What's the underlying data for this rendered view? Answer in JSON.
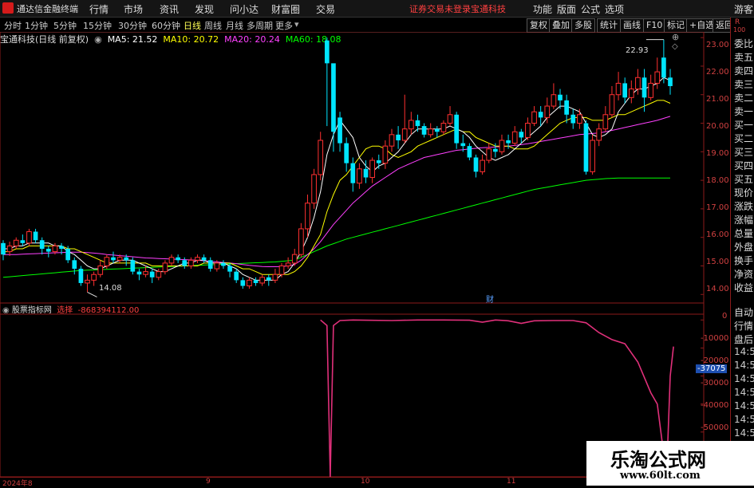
{
  "app": {
    "title": "通达信金融终端"
  },
  "menu": {
    "items": [
      "行情",
      "市场",
      "资讯",
      "发现",
      "问小达",
      "财富圈",
      "交易"
    ],
    "notice": "证券交易未登录",
    "stock_name": "宝通科技",
    "right_items": [
      "功能",
      "版面",
      "公式",
      "选项"
    ],
    "guest": "游客"
  },
  "periods": {
    "tabs": [
      "分时",
      "1分钟",
      "5分钟",
      "15分钟",
      "30分钟",
      "60分钟",
      "日线",
      "周线",
      "月线",
      "多周期",
      "更多"
    ],
    "active": "日线"
  },
  "toolbar_right": [
    "复权",
    "叠加",
    "多股",
    "统计",
    "画线",
    "F10",
    "标记",
    "+自选",
    "返回"
  ],
  "info": {
    "stock_label": "宝通科技(日线 前复权)",
    "ma5": "MA5: 21.52",
    "ma10": "MA10: 20.72",
    "ma20": "MA20: 20.24",
    "ma60": "MA60: 18.08",
    "colors": {
      "ma5": "#ffffff",
      "ma10": "#ffff00",
      "ma20": "#ff40ff",
      "ma60": "#00ff00"
    }
  },
  "main_chart": {
    "y_ticks": [
      "23.00",
      "22.00",
      "21.00",
      "20.00",
      "19.00",
      "18.00",
      "17.00",
      "16.00",
      "15.00",
      "14.00"
    ],
    "high_label": "22.93",
    "low_label": "14.08",
    "event_label": "财"
  },
  "indicator": {
    "title": "股票指标网",
    "mode": "选择",
    "value": "-868394112.00",
    "y_ticks": [
      "0",
      "-10000",
      "-20000",
      "-30000",
      "-40000",
      "-50000"
    ],
    "current_label": "-37075",
    "line_color": "#e0307a"
  },
  "xaxis": {
    "labels": [
      "2024年8",
      "9",
      "10",
      "11"
    ]
  },
  "right_panel": {
    "top_labels": [
      "R",
      "100"
    ],
    "items": [
      "委比",
      "卖五",
      "卖四",
      "卖三",
      "卖二",
      "卖一",
      "买一",
      "买二",
      "买三",
      "买四",
      "买五",
      "现价",
      "涨跌",
      "涨幅",
      "总量",
      "外盘",
      "换手",
      "净资",
      "收益"
    ],
    "lower_items": [
      "自动",
      "行情",
      "盘后",
      "14:5",
      "14:5",
      "14:5",
      "14:5",
      "14:5",
      "14:5",
      "14:5",
      "14:5",
      "14:5"
    ]
  },
  "watermark": {
    "line1": "乐淘公式网",
    "line2": "www.60lt.com"
  },
  "chart_data": {
    "type": "candlestick",
    "up_color": "#ff3030",
    "down_color": "#00e5ff",
    "ylim": [
      13.7,
      23.2
    ],
    "candles": [
      [
        15.8,
        15.4,
        15.9,
        15.2
      ],
      [
        15.5,
        15.7,
        15.85,
        15.35
      ],
      [
        15.7,
        15.9,
        16.0,
        15.6
      ],
      [
        15.9,
        15.8,
        16.1,
        15.7
      ],
      [
        15.8,
        16.2,
        16.3,
        15.7
      ],
      [
        16.2,
        15.9,
        16.3,
        15.8
      ],
      [
        15.9,
        15.6,
        16.0,
        15.4
      ],
      [
        15.6,
        15.5,
        15.7,
        15.3
      ],
      [
        15.5,
        15.7,
        15.8,
        15.4
      ],
      [
        15.7,
        15.6,
        15.8,
        15.4
      ],
      [
        15.6,
        15.2,
        15.7,
        15.1
      ],
      [
        15.2,
        14.9,
        15.3,
        14.7
      ],
      [
        14.9,
        14.4,
        15.0,
        14.3
      ],
      [
        14.4,
        14.5,
        14.7,
        14.08
      ],
      [
        14.5,
        14.7,
        14.8,
        14.3
      ],
      [
        14.7,
        15.0,
        15.2,
        14.6
      ],
      [
        15.0,
        15.3,
        15.4,
        14.9
      ],
      [
        15.3,
        15.2,
        15.5,
        15.1
      ],
      [
        15.2,
        15.3,
        15.4,
        15.1
      ],
      [
        15.3,
        15.2,
        15.4,
        15.0
      ],
      [
        15.2,
        14.8,
        15.3,
        14.7
      ],
      [
        14.8,
        14.7,
        14.9,
        14.5
      ],
      [
        14.7,
        14.8,
        15.0,
        14.6
      ],
      [
        14.8,
        14.6,
        14.9,
        14.4
      ],
      [
        14.6,
        14.8,
        14.9,
        14.5
      ],
      [
        14.8,
        15.1,
        15.2,
        14.7
      ],
      [
        15.1,
        15.3,
        15.4,
        15.0
      ],
      [
        15.3,
        15.2,
        15.4,
        15.1
      ],
      [
        15.2,
        15.0,
        15.3,
        14.9
      ],
      [
        15.0,
        15.2,
        15.3,
        14.9
      ],
      [
        15.2,
        15.3,
        15.4,
        15.1
      ],
      [
        15.3,
        15.2,
        15.4,
        15.1
      ],
      [
        15.2,
        14.9,
        15.3,
        14.8
      ],
      [
        14.9,
        15.1,
        15.2,
        14.8
      ],
      [
        15.1,
        15.0,
        15.2,
        14.9
      ],
      [
        15.0,
        14.8,
        15.1,
        14.6
      ],
      [
        14.8,
        14.5,
        14.9,
        14.4
      ],
      [
        14.5,
        14.3,
        14.6,
        14.2
      ],
      [
        14.3,
        14.5,
        14.6,
        14.2
      ],
      [
        14.5,
        14.4,
        14.6,
        14.3
      ],
      [
        14.4,
        14.6,
        14.7,
        14.3
      ],
      [
        14.6,
        14.5,
        14.7,
        14.3
      ],
      [
        14.5,
        14.7,
        14.9,
        14.4
      ],
      [
        14.7,
        15.0,
        15.1,
        14.6
      ],
      [
        15.0,
        15.1,
        15.3,
        14.9
      ],
      [
        15.1,
        15.4,
        15.6,
        15.0
      ],
      [
        15.4,
        16.3,
        16.5,
        15.3
      ],
      [
        16.3,
        17.2,
        17.5,
        16.0
      ],
      [
        17.2,
        18.2,
        18.4,
        17.0
      ],
      [
        18.2,
        19.4,
        19.7,
        18.0
      ],
      [
        22.9,
        22.1,
        23.0,
        19.9
      ],
      [
        22.1,
        19.7,
        21.0,
        19.0
      ],
      [
        20.2,
        19.3,
        20.4,
        19.0
      ],
      [
        19.3,
        18.6,
        19.5,
        18.3
      ],
      [
        18.6,
        17.9,
        18.8,
        17.6
      ],
      [
        17.9,
        18.4,
        18.6,
        17.7
      ],
      [
        18.4,
        18.1,
        18.7,
        17.9
      ],
      [
        18.1,
        18.7,
        18.8,
        17.9
      ],
      [
        18.7,
        18.6,
        18.9,
        18.4
      ],
      [
        18.6,
        19.2,
        19.4,
        18.4
      ],
      [
        19.2,
        19.6,
        19.8,
        19.0
      ],
      [
        19.6,
        19.4,
        19.9,
        19.1
      ],
      [
        19.4,
        19.8,
        21.0,
        19.3
      ],
      [
        19.8,
        20.1,
        20.4,
        19.6
      ],
      [
        20.1,
        19.9,
        20.3,
        19.7
      ],
      [
        19.9,
        19.6,
        20.0,
        19.5
      ],
      [
        19.6,
        19.8,
        20.0,
        19.5
      ],
      [
        19.8,
        19.7,
        19.9,
        19.5
      ],
      [
        19.7,
        20.0,
        20.1,
        19.6
      ],
      [
        20.0,
        20.3,
        20.6,
        19.9
      ],
      [
        20.3,
        19.3,
        20.4,
        19.1
      ],
      [
        19.3,
        19.2,
        19.6,
        19.0
      ],
      [
        19.2,
        18.8,
        19.3,
        18.7
      ],
      [
        18.8,
        18.3,
        18.9,
        18.1
      ],
      [
        18.3,
        18.7,
        18.9,
        18.2
      ],
      [
        18.7,
        19.1,
        19.3,
        18.6
      ],
      [
        19.1,
        19.0,
        19.3,
        18.8
      ],
      [
        19.0,
        19.4,
        19.6,
        18.9
      ],
      [
        19.4,
        19.3,
        19.6,
        19.1
      ],
      [
        19.3,
        19.7,
        19.9,
        19.2
      ],
      [
        19.7,
        19.5,
        19.8,
        19.3
      ],
      [
        19.5,
        20.0,
        20.2,
        19.4
      ],
      [
        20.0,
        20.4,
        20.6,
        19.9
      ],
      [
        20.4,
        20.2,
        20.6,
        19.9
      ],
      [
        20.2,
        20.6,
        20.9,
        20.0
      ],
      [
        20.6,
        21.0,
        21.4,
        20.5
      ],
      [
        21.0,
        20.8,
        21.2,
        20.5
      ],
      [
        20.8,
        20.3,
        21.0,
        20.0
      ],
      [
        20.3,
        20.0,
        20.5,
        19.8
      ],
      [
        20.0,
        20.3,
        20.5,
        19.8
      ],
      [
        20.0,
        18.3,
        20.1,
        18.2
      ],
      [
        18.3,
        19.4,
        19.6,
        18.2
      ],
      [
        19.4,
        19.8,
        20.0,
        19.2
      ],
      [
        19.8,
        20.3,
        20.6,
        19.7
      ],
      [
        20.3,
        21.0,
        21.3,
        20.2
      ],
      [
        21.0,
        21.4,
        21.8,
        20.8
      ],
      [
        21.4,
        20.9,
        21.6,
        20.7
      ],
      [
        20.9,
        21.2,
        21.5,
        20.7
      ],
      [
        21.2,
        21.6,
        21.9,
        21.0
      ],
      [
        21.6,
        20.9,
        21.9,
        20.4
      ],
      [
        20.9,
        21.4,
        21.7,
        20.8
      ],
      [
        21.4,
        21.8,
        22.3,
        21.2
      ],
      [
        22.3,
        21.6,
        22.93,
        21.4
      ],
      [
        21.6,
        21.3,
        21.9,
        21.0
      ]
    ],
    "ma5": [
      15.6,
      15.6,
      15.7,
      15.7,
      15.8,
      15.8,
      15.8,
      15.8,
      15.7,
      15.7,
      15.5,
      15.4,
      15.2,
      15.0,
      14.9,
      14.9,
      15.0,
      15.1,
      15.2,
      15.2,
      15.2,
      15.1,
      15.0,
      14.9,
      14.8,
      14.8,
      14.9,
      15.0,
      15.1,
      15.1,
      15.2,
      15.2,
      15.1,
      15.1,
      15.1,
      15.0,
      14.9,
      14.7,
      14.6,
      14.5,
      14.5,
      14.5,
      14.5,
      14.7,
      14.8,
      15.1,
      15.5,
      16.0,
      16.7,
      17.6,
      18.9,
      19.6,
      20.1,
      19.8,
      19.5,
      18.8,
      18.5,
      18.3,
      18.5,
      18.6,
      18.8,
      19.0,
      19.3,
      19.6,
      19.8,
      19.8,
      19.8,
      19.8,
      19.8,
      19.9,
      19.8,
      19.7,
      19.5,
      19.2,
      19.0,
      18.8,
      18.7,
      18.8,
      18.9,
      19.1,
      19.3,
      19.5,
      19.7,
      19.9,
      20.2,
      20.4,
      20.6,
      20.6,
      20.5,
      20.4,
      20.0,
      19.6,
      19.5,
      19.6,
      19.8,
      20.4,
      20.7,
      21.0,
      21.2,
      21.2,
      21.3,
      21.4,
      21.6,
      21.5
    ],
    "ma10": [
      15.5,
      15.5,
      15.6,
      15.6,
      15.7,
      15.7,
      15.7,
      15.7,
      15.7,
      15.7,
      15.6,
      15.6,
      15.5,
      15.4,
      15.3,
      15.2,
      15.1,
      15.1,
      15.1,
      15.1,
      15.1,
      15.1,
      15.1,
      15.0,
      15.0,
      15.0,
      15.0,
      15.0,
      15.0,
      15.0,
      15.0,
      15.1,
      15.1,
      15.1,
      15.1,
      15.1,
      15.0,
      14.9,
      14.9,
      14.8,
      14.7,
      14.7,
      14.7,
      14.7,
      14.7,
      14.8,
      15.0,
      15.3,
      15.7,
      16.1,
      16.9,
      17.5,
      18.0,
      18.2,
      18.5,
      18.8,
      19.1,
      19.2,
      19.2,
      19.1,
      18.9,
      18.8,
      18.9,
      19.0,
      19.2,
      19.3,
      19.4,
      19.5,
      19.6,
      19.7,
      19.8,
      19.7,
      19.7,
      19.5,
      19.4,
      19.3,
      19.2,
      19.2,
      19.2,
      19.1,
      19.1,
      19.1,
      19.2,
      19.4,
      19.6,
      19.8,
      20.0,
      20.1,
      20.2,
      20.2,
      20.2,
      20.1,
      20.1,
      20.1,
      20.2,
      20.3,
      20.3,
      20.4,
      20.5,
      20.6,
      20.7,
      20.8,
      20.8,
      20.7
    ],
    "ma20": [
      15.4,
      15.4,
      15.4,
      15.41,
      15.42,
      15.43,
      15.44,
      15.45,
      15.46,
      15.47,
      15.48,
      15.48,
      15.48,
      15.47,
      15.45,
      15.43,
      15.4,
      15.38,
      15.36,
      15.34,
      15.32,
      15.3,
      15.28,
      15.27,
      15.26,
      15.25,
      15.24,
      15.23,
      15.22,
      15.21,
      15.2,
      15.18,
      15.16,
      15.14,
      15.12,
      15.1,
      15.08,
      15.05,
      15.02,
      15.0,
      14.98,
      14.97,
      14.97,
      14.98,
      15.0,
      15.05,
      15.2,
      15.4,
      15.6,
      15.85,
      16.15,
      16.45,
      16.7,
      16.95,
      17.2,
      17.4,
      17.6,
      17.8,
      17.95,
      18.1,
      18.25,
      18.4,
      18.5,
      18.6,
      18.7,
      18.8,
      18.85,
      18.9,
      18.95,
      19.0,
      19.05,
      19.07,
      19.1,
      19.12,
      19.14,
      19.15,
      19.17,
      19.18,
      19.2,
      19.22,
      19.25,
      19.28,
      19.32,
      19.36,
      19.4,
      19.44,
      19.48,
      19.52,
      19.56,
      19.6,
      19.62,
      19.64,
      19.66,
      19.7,
      19.75,
      19.8,
      19.85,
      19.9,
      19.95,
      20.0,
      20.05,
      20.1,
      20.17,
      20.24
    ],
    "ma60": [
      14.6,
      14.62,
      14.64,
      14.66,
      14.68,
      14.7,
      14.72,
      14.74,
      14.76,
      14.78,
      14.8,
      14.82,
      14.84,
      14.85,
      14.86,
      14.87,
      14.88,
      14.89,
      14.9,
      14.91,
      14.92,
      14.93,
      14.94,
      14.95,
      14.96,
      14.97,
      14.98,
      14.99,
      15.0,
      15.01,
      15.02,
      15.03,
      15.04,
      15.05,
      15.06,
      15.07,
      15.08,
      15.09,
      15.1,
      15.11,
      15.12,
      15.13,
      15.14,
      15.16,
      15.18,
      15.2,
      15.3,
      15.4,
      15.5,
      15.6,
      15.7,
      15.78,
      15.86,
      15.94,
      16.0,
      16.06,
      16.12,
      16.18,
      16.24,
      16.3,
      16.36,
      16.42,
      16.48,
      16.54,
      16.6,
      16.66,
      16.72,
      16.78,
      16.84,
      16.9,
      16.96,
      17.02,
      17.08,
      17.14,
      17.2,
      17.26,
      17.32,
      17.38,
      17.44,
      17.5,
      17.56,
      17.62,
      17.68,
      17.72,
      17.76,
      17.8,
      17.84,
      17.88,
      17.92,
      17.96,
      18.0,
      18.02,
      18.04,
      18.06,
      18.07,
      18.08,
      18.08,
      18.08,
      18.08,
      18.08,
      18.08,
      18.08,
      18.08,
      18.08
    ],
    "indicator_ylim": [
      -56000,
      1500
    ],
    "indicator_line": {
      "x_index": [
        49,
        50,
        50.5,
        51,
        52,
        54,
        56,
        60,
        64,
        68,
        72,
        74,
        76,
        78,
        80,
        82,
        85,
        88,
        90,
        92,
        94,
        96,
        98,
        100,
        101,
        102,
        102.5,
        103,
        103.5
      ],
      "y": [
        0,
        -2000,
        -56000,
        -2000,
        -200,
        0,
        -100,
        -200,
        0,
        0,
        -100,
        -800,
        0,
        -300,
        -1200,
        -300,
        -200,
        -200,
        -1000,
        -4500,
        -7000,
        -8500,
        -15000,
        -26000,
        -30000,
        -48000,
        -52000,
        -20000,
        -9500
      ]
    }
  }
}
